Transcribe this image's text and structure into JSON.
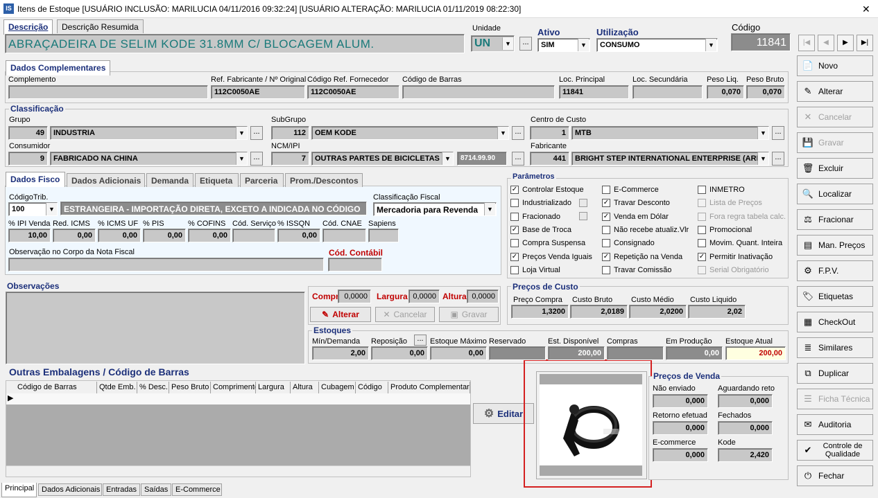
{
  "window": {
    "title": "Itens de Estoque  [USUÁRIO INCLUSÃO: MARILUCIA 04/11/2016 09:32:24]  [USUÁRIO ALTERAÇÃO: MARILUCIA 01/11/2019 08:22:30]",
    "logo": "IS",
    "close": "✕"
  },
  "desc_tabs": [
    "Descrição",
    "Descrição Resumida"
  ],
  "description": "ABRAÇADEIRA DE SELIM KODE 31.8MM C/ BLOCAGEM ALUM.",
  "unidade": {
    "label": "Unidade",
    "value": "UN",
    "dots": "..."
  },
  "ativo": {
    "label": "Ativo",
    "value": "SIM"
  },
  "utilizacao": {
    "label": "Utilização",
    "value": "CONSUMO"
  },
  "codigo": {
    "label": "Código",
    "value": "11841"
  },
  "nav": {
    "first": "|◀",
    "prev": "◀",
    "next": "▶",
    "last": "▶|"
  },
  "complementares": {
    "title": "Dados Complementares",
    "labels": [
      "Complemento",
      "Ref. Fabricante / Nº Original",
      "Código Ref. Fornecedor",
      "Código de Barras",
      "Loc. Principal",
      "Loc. Secundária",
      "Peso Liq.",
      "Peso Bruto"
    ],
    "values": [
      "",
      "112C0050AE",
      "112C0050AE",
      "",
      "11841",
      "",
      "0,070",
      "0,070"
    ]
  },
  "classificacao": {
    "title": "Classificação",
    "grupo_label": "Grupo",
    "grupo_code": "49",
    "grupo_name": "INDUSTRIA",
    "subgrupo_label": "SubGrupo",
    "subgrupo_code": "112",
    "subgrupo_name": "OEM KODE",
    "cc_label": "Centro de Custo",
    "cc_code": "1",
    "cc_name": "MTB",
    "consumidor_label": "Consumidor",
    "consumidor_code": "9",
    "consumidor_name": "FABRICADO NA CHINA",
    "ncm_label": "NCM/IPI",
    "ncm_code": "7",
    "ncm_name": "OUTRAS PARTES DE BICICLETAS -I",
    "ncm_num": "8714.99.90",
    "fab_label": "Fabricante",
    "fab_code": "441",
    "fab_name": "BRIGHT STEP INTERNATIONAL ENTERPRISE (ARMOR"
  },
  "fisco_tabs": [
    "Dados Fisco",
    "Dados Adicionais",
    "Demanda",
    "Etiqueta",
    "Parceria",
    "Prom./Descontos"
  ],
  "fisco": {
    "codtrib_label": "CódigoTrib.",
    "codtrib": "100",
    "codtrib_desc": "ESTRANGEIRA - IMPORTAÇÃO DIRETA, EXCETO A INDICADA NO CÓDIGO",
    "class_label": "Classificação Fiscal",
    "class_value": "Mercadoria para Revenda",
    "labels": [
      "% IPI Venda",
      "Red. ICMS",
      "% ICMS UF",
      "% PIS",
      "% COFINS",
      "Cód. Serviço",
      "% ISSQN",
      "Cód. CNAE",
      "Sapiens"
    ],
    "values": [
      "10,00",
      "0,00",
      "0,00",
      "0,00",
      "0,00",
      "",
      "0,00",
      "",
      ""
    ],
    "obs_label": "Observação no Corpo da Nota Fiscal",
    "contabil_label": "Cód. Contábil"
  },
  "parametros": {
    "title": "Parâmetros",
    "items": [
      {
        "label": "Controlar Estoque",
        "checked": true,
        "disabled": false
      },
      {
        "label": "Industrializado",
        "checked": false,
        "disabled": false
      },
      {
        "label": "Fracionado",
        "checked": false,
        "disabled": false
      },
      {
        "label": "Base de Troca",
        "checked": true,
        "disabled": false
      },
      {
        "label": "Compra Suspensa",
        "checked": false,
        "disabled": false
      },
      {
        "label": "Preços Venda Iguais",
        "checked": true,
        "disabled": false
      },
      {
        "label": "Loja Virtual",
        "checked": false,
        "disabled": false
      },
      {
        "label": "E-Commerce",
        "checked": false,
        "disabled": false
      },
      {
        "label": "Travar Desconto",
        "checked": true,
        "disabled": false
      },
      {
        "label": "Venda em Dólar",
        "checked": true,
        "disabled": false
      },
      {
        "label": "Não recebe atualiz.Vlr",
        "checked": false,
        "disabled": false
      },
      {
        "label": "Consignado",
        "checked": false,
        "disabled": false
      },
      {
        "label": "Repetição na Venda",
        "checked": true,
        "disabled": false
      },
      {
        "label": "Travar Comissão",
        "checked": false,
        "disabled": false
      },
      {
        "label": "INMETRO",
        "checked": false,
        "disabled": false
      },
      {
        "label": "Lista de Preços",
        "checked": false,
        "disabled": true
      },
      {
        "label": "Fora regra tabela calc.",
        "checked": false,
        "disabled": true
      },
      {
        "label": "Promocional",
        "checked": false,
        "disabled": false
      },
      {
        "label": "Movim. Quant. Inteira",
        "checked": false,
        "disabled": false
      },
      {
        "label": "Permitir Inativação",
        "checked": true,
        "disabled": false
      },
      {
        "label": "Serial Obrigatório",
        "checked": false,
        "disabled": true
      }
    ]
  },
  "observacoes": {
    "title": "Observações"
  },
  "dims": {
    "compr_label": "Compr",
    "compr": "0,0000",
    "largura_label": "Largura",
    "largura": "0,0000",
    "altura_label": "Altura",
    "altura": "0,0000",
    "alterar": "Alterar",
    "cancelar": "Cancelar",
    "gravar": "Gravar"
  },
  "custo": {
    "title": "Preços de Custo",
    "labels": [
      "Preço Compra",
      "Custo Bruto",
      "Custo Médio",
      "Custo Liquido"
    ],
    "values": [
      "1,3200",
      "2,0189",
      "2,0200",
      "2,02"
    ]
  },
  "estoques": {
    "title": "Estoques",
    "labels": [
      "Mín/Demanda",
      "Reposição",
      "Estoque Máximo",
      "Reservado",
      "Est. Disponível",
      "Compras",
      "Em Produção",
      "Estoque Atual"
    ],
    "values": [
      "2,00",
      "0,00",
      "0,00",
      "",
      "200,00",
      "",
      "0,00",
      "200,00"
    ]
  },
  "embalagens": {
    "title": "Outras Embalagens / Código de Barras",
    "columns": [
      "Código de Barras",
      "Qtde Emb.",
      "% Desc.",
      "Peso Bruto",
      "Comprimento",
      "Largura",
      "Altura",
      "Cubagem",
      "Código",
      "Produto Complementar"
    ],
    "editar": "Editar"
  },
  "venda": {
    "title": "Preços de Venda",
    "labels": [
      "Não enviado",
      "Aguardando reto",
      "Retorno efetuad",
      "Fechados",
      "E-commerce",
      "Kode"
    ],
    "values": [
      "0,000",
      "0,000",
      "0,000",
      "0,000",
      "0,000",
      "2,420"
    ]
  },
  "sidebar": [
    {
      "label": "Novo",
      "icon": "📄",
      "disabled": false
    },
    {
      "label": "Alterar",
      "icon": "✎",
      "disabled": false
    },
    {
      "label": "Cancelar",
      "icon": "✕",
      "disabled": true
    },
    {
      "label": "Gravar",
      "icon": "💾",
      "disabled": true
    },
    {
      "label": "Excluir",
      "icon": "🗑",
      "disabled": false
    },
    {
      "label": "Localizar",
      "icon": "🔍",
      "disabled": false
    },
    {
      "label": "Fracionar",
      "icon": "⚖",
      "disabled": false
    },
    {
      "label": "Man. Preços",
      "icon": "▤",
      "disabled": false
    },
    {
      "label": "F.P.V.",
      "icon": "⚙",
      "disabled": false
    },
    {
      "label": "Etiquetas",
      "icon": "🏷",
      "disabled": false
    },
    {
      "label": "CheckOut",
      "icon": "▦",
      "disabled": false
    },
    {
      "label": "Similares",
      "icon": "≣",
      "disabled": false
    },
    {
      "label": "Duplicar",
      "icon": "⧉",
      "disabled": false
    },
    {
      "label": "Ficha Técnica",
      "icon": "☰",
      "disabled": true
    },
    {
      "label": "Auditoria",
      "icon": "✉",
      "disabled": false
    },
    {
      "label": "Controle de Qualidade",
      "icon": "✔",
      "disabled": false
    },
    {
      "label": "Fechar",
      "icon": "⏻",
      "disabled": false
    }
  ],
  "bottom_tabs": [
    "Principal",
    "Dados Adicionais",
    "Entradas",
    "Saídas",
    "E-Commerce"
  ]
}
